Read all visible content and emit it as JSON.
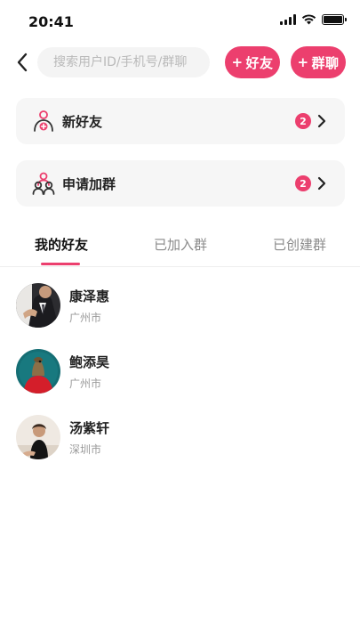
{
  "status_bar": {
    "time": "20:41"
  },
  "search": {
    "placeholder": "搜索用户ID/手机号/群聊"
  },
  "header": {
    "add_friend_label": "好友",
    "add_group_label": "群聊",
    "plus": "+"
  },
  "entries": [
    {
      "label": "新好友",
      "badge": "2",
      "icon": "add-user-icon"
    },
    {
      "label": "申请加群",
      "badge": "2",
      "icon": "group-icon"
    }
  ],
  "tabs": [
    {
      "label": "我的好友",
      "active": true
    },
    {
      "label": "已加入群",
      "active": false
    },
    {
      "label": "已创建群",
      "active": false
    }
  ],
  "friends": [
    {
      "name": "康泽惠",
      "city": "广州市"
    },
    {
      "name": "鲍添昊",
      "city": "广州市"
    },
    {
      "name": "汤紫轩",
      "city": "深圳市"
    }
  ],
  "colors": {
    "accent": "#ec3f6e",
    "card_bg": "#f6f6f6",
    "search_bg": "#f4f4f4"
  }
}
